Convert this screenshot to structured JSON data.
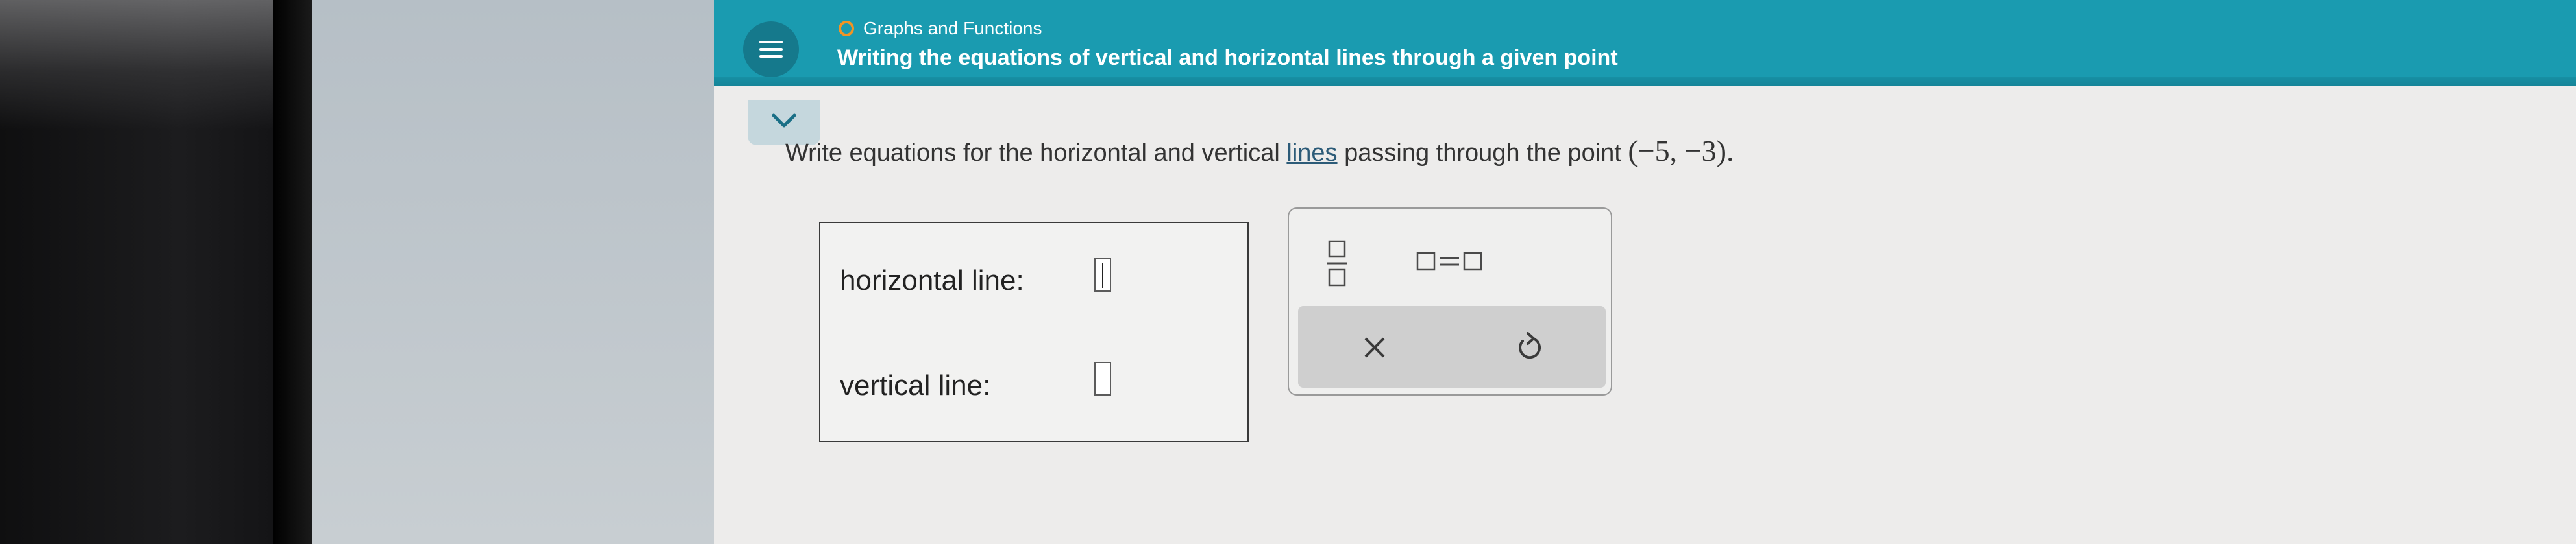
{
  "header": {
    "chapter": "Graphs and Functions",
    "topic_title": "Writing the equations of vertical and horizontal lines through a given point"
  },
  "question": {
    "text_before": "Write equations for the horizontal and vertical ",
    "link_text": "lines",
    "text_after": " passing through the point ",
    "point": "(−5, −3)",
    "trailing": "."
  },
  "answers": {
    "horizontal_label": "horizontal line:",
    "vertical_label": "vertical line:"
  },
  "tools": {
    "fraction_icon": "fraction-template-icon",
    "equation_icon": "equals-template-icon",
    "clear_icon": "close-icon",
    "undo_icon": "undo-icon"
  },
  "colors": {
    "header_bg": "#1a9bb0",
    "chapter_dot": "#f29423",
    "link": "#2c5b78"
  }
}
